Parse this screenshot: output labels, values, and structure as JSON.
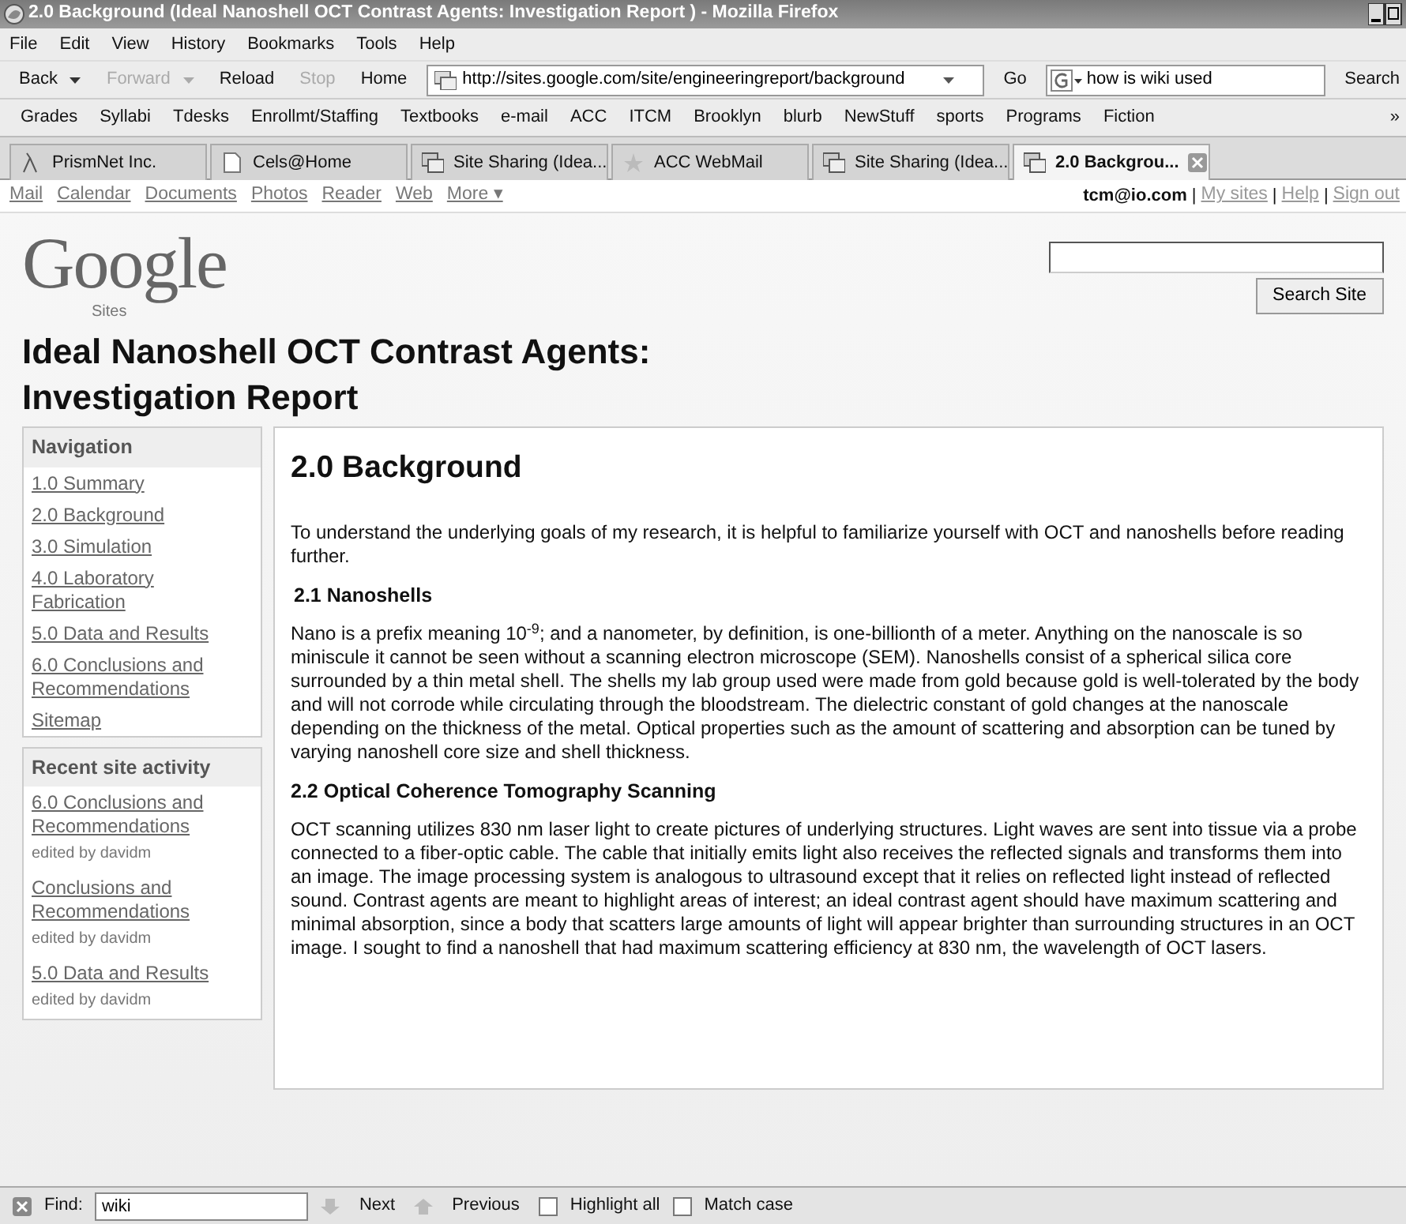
{
  "window": {
    "title": "2.0 Background (Ideal Nanoshell OCT Contrast Agents: Investigation Report ) - Mozilla Firefox"
  },
  "menu": [
    "File",
    "Edit",
    "View",
    "History",
    "Bookmarks",
    "Tools",
    "Help"
  ],
  "toolbar": {
    "buttons": [
      {
        "label": "Back",
        "disabled": false,
        "dropdown": true
      },
      {
        "label": "Forward",
        "disabled": true,
        "dropdown": true
      },
      {
        "label": "Reload",
        "disabled": false,
        "dropdown": false
      },
      {
        "label": "Stop",
        "disabled": true,
        "dropdown": false
      },
      {
        "label": "Home",
        "disabled": false,
        "dropdown": false
      }
    ],
    "url": "http://sites.google.com/site/engineeringreport/background",
    "go": "Go",
    "search_value": "how is wiki used",
    "search_button": "Search"
  },
  "bookmarks": [
    "Grades",
    "Syllabi",
    "Tdesks",
    "Enrollmt/Staffing",
    "Textbooks",
    "e-mail",
    "ACC",
    "ITCM",
    "Brooklyn",
    "blurb",
    "NewStuff",
    "sports",
    "Programs",
    "Fiction"
  ],
  "bookmarks_overflow": "»",
  "tabs": [
    {
      "label": "PrismNet Inc.",
      "selected": false,
      "kind": "lambda"
    },
    {
      "label": "Cels@Home",
      "selected": false,
      "kind": "page"
    },
    {
      "label": "Site Sharing (Idea...",
      "selected": false,
      "kind": "sites"
    },
    {
      "label": "ACC WebMail",
      "selected": false,
      "kind": "star"
    },
    {
      "label": "Site Sharing (Idea...",
      "selected": false,
      "kind": "sites"
    },
    {
      "label": "2.0 Backgrou...",
      "selected": true,
      "kind": "sites"
    }
  ],
  "google_bar": {
    "links": [
      "Mail",
      "Calendar",
      "Documents",
      "Photos",
      "Reader",
      "Web",
      "More ▾"
    ],
    "user": "tcm@io.com",
    "account_links": [
      "My sites",
      "Help",
      "Sign out"
    ],
    "separator": "|"
  },
  "site": {
    "logo": "Google",
    "logo_sub": "Sites",
    "search_button": "Search Site",
    "title": "Ideal Nanoshell OCT Contrast Agents: Investigation Report"
  },
  "navigation": {
    "heading": "Navigation",
    "items": [
      "1.0 Summary",
      "2.0 Background",
      "3.0 Simulation",
      "4.0 Laboratory Fabrication",
      "5.0 Data and Results",
      "6.0 Conclusions and Recommendations",
      "Sitemap"
    ]
  },
  "recent": {
    "heading": "Recent site activity",
    "items": [
      {
        "label": "6.0 Conclusions and Recommendations",
        "note": "edited by davidm"
      },
      {
        "label": "Conclusions and Recommendations",
        "note": "edited by davidm"
      },
      {
        "label": "5.0 Data and Results",
        "note": "edited by davidm"
      }
    ]
  },
  "article": {
    "heading": "2.0 Background",
    "intro": "To understand the underlying goals of my research, it is helpful to familiarize yourself with OCT and nanoshells before reading further.",
    "sections": [
      {
        "heading": "2.1 Nanoshells",
        "body": "Nano is a prefix meaning 10$^{-9}$; and a nanometer, by definition, is one-billionth of a meter. Anything on the nanoscale is so miniscule it cannot be seen without a scanning electron microscope (SEM). Nanoshells consist of a spherical silica core surrounded by a thin metal shell. The shells my lab group used were made from gold because gold is well-tolerated by the body and will not corrode while circulating through the bloodstream. The dielectric constant of gold changes at the nanoscale depending on the thickness of the metal. Optical properties such as the amount of scattering and absorption can be tuned by varying nanoshell core size and shell thickness."
      },
      {
        "heading": "2.2 Optical Coherence Tomography Scanning",
        "body": "OCT scanning utilizes 830 nm laser light to create pictures of underlying structures. Light waves are sent into tissue via a probe connected to a fiber-optic cable. The cable that initially emits light also receives the reflected signals and transforms them into an image. The image processing system is analogous to ultrasound except that it relies on reflected light instead of reflected sound. Contrast agents are meant to highlight areas of interest; an ideal contrast agent should have maximum scattering and minimal absorption, since a body that scatters large amounts of light will appear brighter than surrounding structures in an OCT image. I sought to find a nanoshell that had maximum scattering efficiency at 830 nm, the wavelength of OCT lasers."
      }
    ]
  },
  "find_bar": {
    "label": "Find:",
    "value": "wiki",
    "next": "Next",
    "previous": "Previous",
    "highlight_all": {
      "label": "Highlight all",
      "checked": false
    },
    "match_case": {
      "label": "Match case",
      "checked": false
    }
  }
}
